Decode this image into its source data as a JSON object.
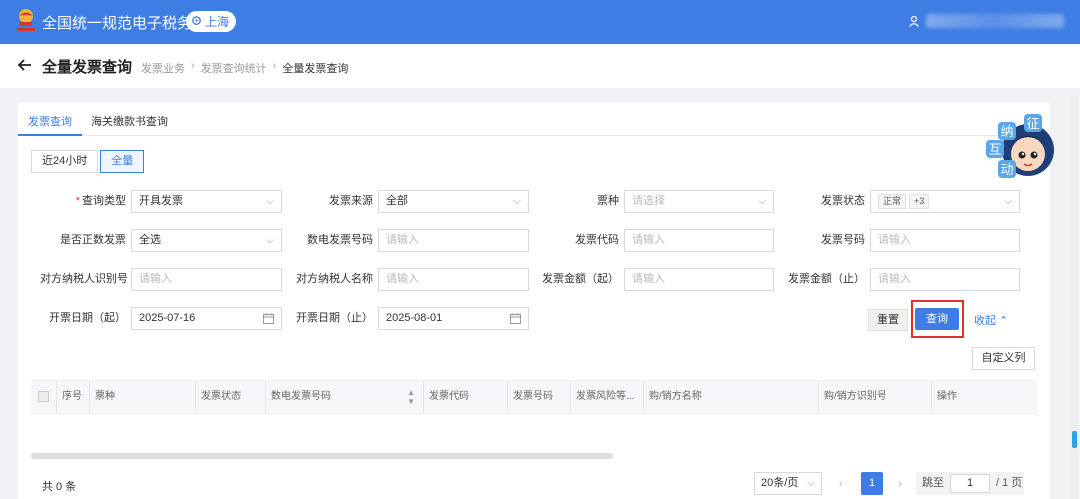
{
  "header": {
    "app_title": "全国统一规范电子税务局",
    "location": "上海",
    "accent_color": "#3e7de4"
  },
  "breadcrumb": {
    "page_title": "全量发票查询",
    "items": [
      "发票业务",
      "发票查询统计",
      "全量发票查询"
    ]
  },
  "tabs": [
    "发票查询",
    "海关缴款书查询"
  ],
  "time_range": {
    "options": [
      "近24小时",
      "全量"
    ],
    "selected": "全量"
  },
  "form": {
    "query_type": {
      "label": "查询类型",
      "value": "开具发票"
    },
    "invoice_source": {
      "label": "发票来源",
      "value": "全部"
    },
    "ticket_type": {
      "label": "票种",
      "placeholder": "请选择"
    },
    "invoice_status": {
      "label": "发票状态",
      "tags": [
        "正常",
        "+3"
      ]
    },
    "is_positive": {
      "label": "是否正数发票",
      "value": "全选"
    },
    "digital_no": {
      "label": "数电发票号码",
      "placeholder": "请输入"
    },
    "invoice_code": {
      "label": "发票代码",
      "placeholder": "请输入"
    },
    "invoice_no": {
      "label": "发票号码",
      "placeholder": "请输入"
    },
    "counter_tax_id": {
      "label": "对方纳税人识别号",
      "placeholder": "请输入"
    },
    "counter_name": {
      "label": "对方纳税人名称",
      "placeholder": "请输入"
    },
    "amount_from": {
      "label": "发票金额（起）",
      "placeholder": "请输入"
    },
    "amount_to": {
      "label": "发票金额（止）",
      "placeholder": "请输入"
    },
    "date_from": {
      "label": "开票日期（起）",
      "value": "2025-07-16"
    },
    "date_to": {
      "label": "开票日期（止）",
      "value": "2025-08-01"
    }
  },
  "actions": {
    "reset": "重置",
    "query": "查询",
    "collapse": "收起",
    "custom_columns": "自定义列"
  },
  "table": {
    "columns": [
      "序号",
      "票种",
      "发票状态",
      "数电发票号码",
      "发票代码",
      "发票号码",
      "发票风险等...",
      "购/销方名称",
      "购/销方识别号",
      "操作"
    ]
  },
  "pagination": {
    "total": "共 0 条",
    "page_size": "20条/页",
    "current": "1",
    "jump_label": "跳至",
    "jump_value": "1",
    "of_pages": "/ 1 页"
  },
  "mascot": {
    "text": [
      "征",
      "纳",
      "互",
      "动"
    ]
  }
}
